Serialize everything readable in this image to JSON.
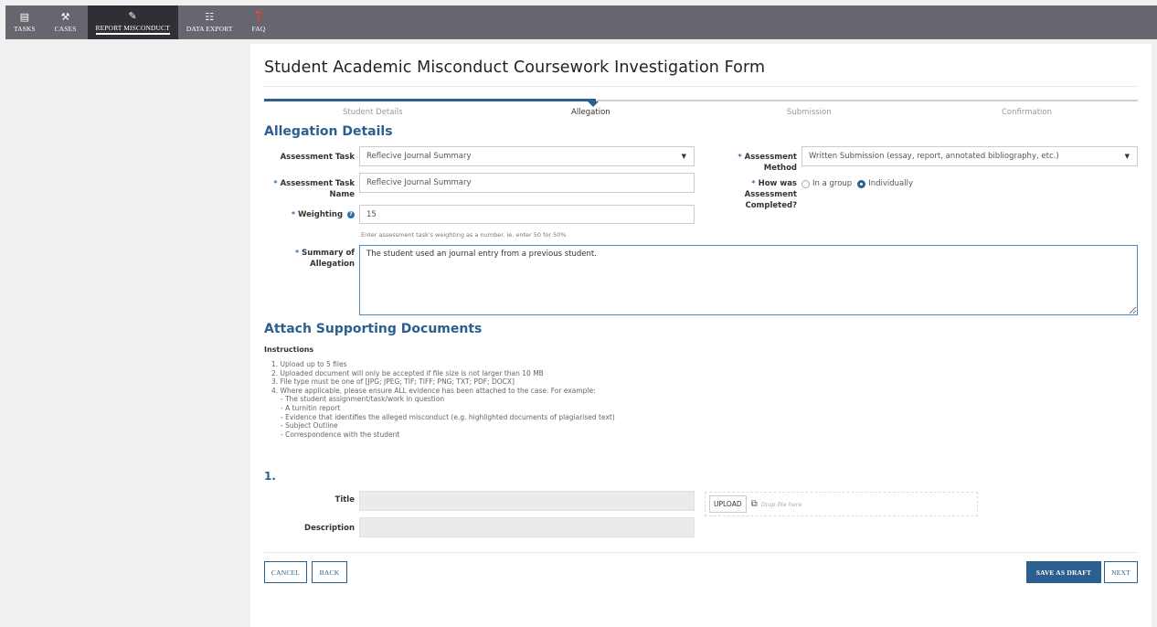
{
  "nav": {
    "items": [
      {
        "label": "TASKS",
        "icon": "tasks-icon"
      },
      {
        "label": "CASES",
        "icon": "gavel-icon"
      },
      {
        "label": "REPORT MISCONDUCT",
        "icon": "edit-icon"
      },
      {
        "label": "DATA EXPORT",
        "icon": "export-icon"
      },
      {
        "label": "FAQ",
        "icon": "help-icon"
      }
    ],
    "active": "REPORT MISCONDUCT"
  },
  "form": {
    "title": "Student Academic Misconduct Coursework Investigation Form"
  },
  "steps": {
    "items": [
      "Student Details",
      "Allegation",
      "Submission",
      "Confirmation"
    ],
    "current": "Allegation"
  },
  "allegation": {
    "heading": "Allegation Details",
    "assessment_task_label": "Assessment Task",
    "assessment_task_value": "Reflecive Journal Summary",
    "assessment_task_name_label": "Assessment Task Name",
    "assessment_task_name_value": "Reflecive Journal Summary",
    "weighting_label": "Weighting",
    "weighting_value": "15",
    "weighting_hint": "Enter assessment task's weighting as a number. ie. enter 50 for 50%",
    "summary_label": "Summary of Allegation",
    "summary_value": "The student used an journal entry from a previous student.",
    "assessment_method_label": "Assessment Method",
    "assessment_method_value": "Written Submission (essay, report, annotated bibliography, etc.)",
    "completion_label": "How was Assessment Completed?",
    "completion_options": [
      "In a group",
      "Individually"
    ],
    "completion_selected": "Individually"
  },
  "documents": {
    "heading": "Attach Supporting Documents",
    "instructions_label": "Instructions",
    "instructions": [
      "1. Upload up to 5 files",
      "2. Uploaded document will only be accepted if file size is not larger than 10 MB",
      "3. File type must be one of [JPG; JPEG; TIF; TIFF; PNG; TXT; PDF; DOCX]",
      "4. Where applicable, please ensure ALL evidence has been attached to the case. For example:"
    ],
    "examples": [
      "- The student assignment/task/work in question",
      "- A turnitin report",
      "- Evidence that identifies the alleged misconduct (e.g. highlighted documents of plagiarised text)",
      "- Subject Outline",
      "- Correspondence with the student"
    ],
    "attachment_number": "1.",
    "title_label": "Title",
    "description_label": "Description",
    "upload_label": "UPLOAD",
    "drop_text": "Drop file here"
  },
  "actions": {
    "cancel": "CANCEL",
    "back": "BACK",
    "save_draft": "SAVE AS DRAFT",
    "next": "NEXT"
  },
  "colors": {
    "nav_bg": "#66666e",
    "nav_active": "#2f2f35",
    "accent": "#2a5f8f"
  }
}
